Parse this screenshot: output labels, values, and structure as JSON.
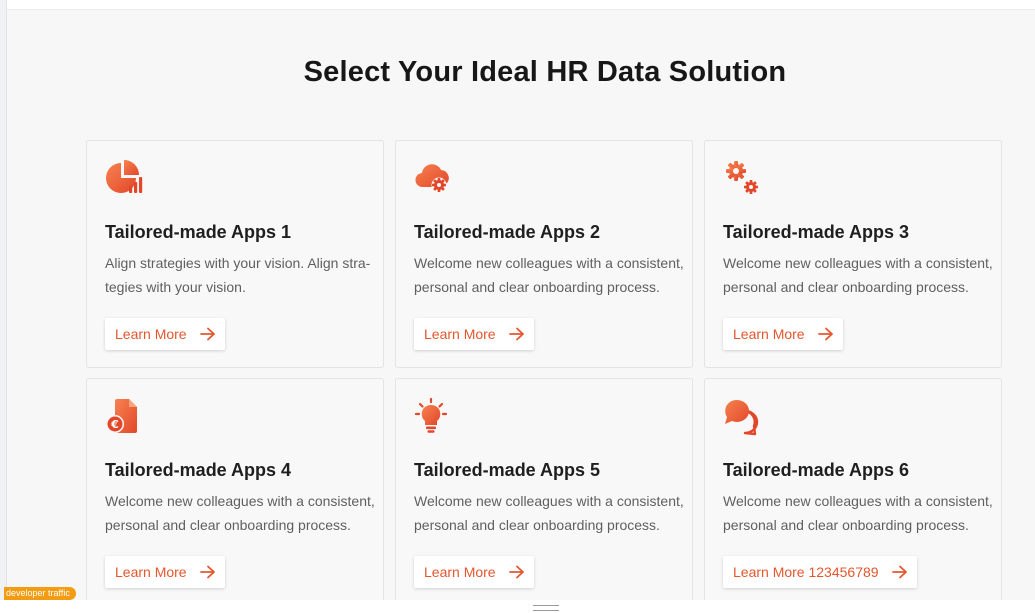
{
  "page": {
    "title": "Select Your Ideal HR Data Solution"
  },
  "colors": {
    "accent": "#e4572e",
    "accent_light": "#f7824f",
    "background": "#f7f7f7"
  },
  "cards": [
    {
      "icon": "pie-chart-icon",
      "title": "Tailored-made Apps 1",
      "description": "Align strategies with your vision. Align stra-tegies with your vision.",
      "button_label": "Learn More"
    },
    {
      "icon": "cloud-gear-icon",
      "title": "Tailored-made Apps 2",
      "description": "Welcome new colleagues with a consistent, personal and clear onboarding process.",
      "button_label": "Learn More"
    },
    {
      "icon": "gears-icon",
      "title": "Tailored-made Apps 3",
      "description": "Welcome new colleagues with a consistent, personal and clear onboarding process.",
      "button_label": "Learn More"
    },
    {
      "icon": "euro-document-icon",
      "title": "Tailored-made Apps 4",
      "description": "Welcome new colleagues with a consistent, personal and clear onboarding process.",
      "button_label": "Learn More"
    },
    {
      "icon": "lightbulb-icon",
      "title": "Tailored-made Apps 5",
      "description": "Welcome new colleagues with a consistent, personal and clear onboarding process.",
      "button_label": "Learn More"
    },
    {
      "icon": "chat-bubbles-icon",
      "title": "Tailored-made Apps 6",
      "description": "Welcome new colleagues with a consistent, personal and clear onboarding process.",
      "button_label": "Learn More 123456789"
    }
  ],
  "badge": {
    "label": "developer traffic"
  }
}
